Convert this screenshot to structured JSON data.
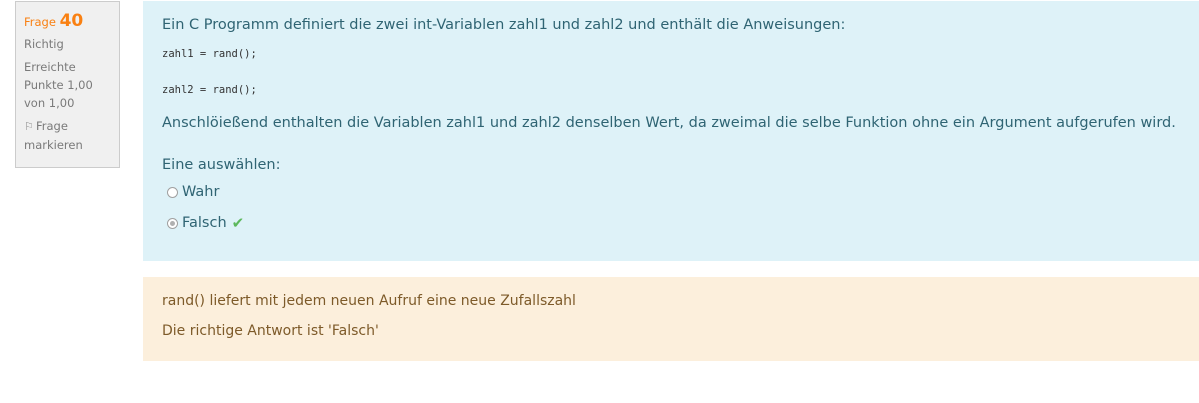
{
  "info": {
    "question_label": "Frage",
    "question_number": "40",
    "state": "Richtig",
    "grade_line1": "Erreichte",
    "grade_line2": "Punkte 1,00",
    "grade_line3": "von 1,00",
    "flag_line1": "Frage",
    "flag_line2": "markieren",
    "flag_icon": "flag-icon"
  },
  "question": {
    "text": "Ein C Programm definiert die zwei int-Variablen zahl1 und zahl2 und enthält die Anweisungen:",
    "code_line1": "zahl1 = rand();",
    "code_line2": "zahl2 = rand();",
    "statement": "Anschlöießend enthalten die Variablen zahl1 und zahl2 denselben Wert, da zweimal die selbe Funktion ohne ein Argument aufgerufen wird.",
    "prompt": "Eine auswählen:",
    "options": [
      {
        "label": "Wahr",
        "selected": false
      },
      {
        "label": "Falsch",
        "selected": true
      }
    ],
    "correct_icon": "check-icon",
    "correct_color": "#5cb85c"
  },
  "feedback": {
    "general": "rand() liefert mit jedem neuen Aufruf eine neue Zufallszahl",
    "right_answer": "Die richtige Antwort ist 'Falsch'"
  },
  "colors": {
    "accent_orange": "#f98012",
    "content_bg": "#def2f8",
    "content_text": "#2f6473",
    "feedback_bg": "#fcefdc",
    "feedback_text": "#7d5a29"
  }
}
